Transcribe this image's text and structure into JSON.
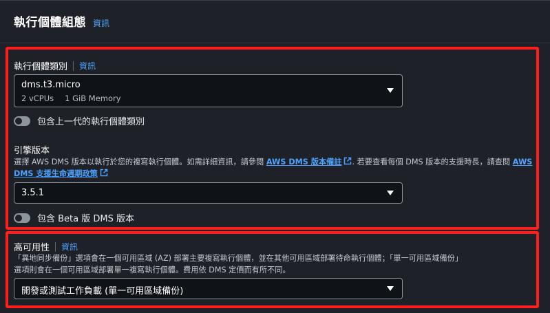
{
  "header": {
    "title": "執行個體組態",
    "info": "資訊"
  },
  "instance_class": {
    "label": "執行個體類別",
    "info": "資訊",
    "selected": "dms.t3.micro",
    "vcpus": "2 vCPUs",
    "memory": "1 GiB Memory",
    "toggle_label": "包含上一代的執行個體類別",
    "toggle_on": false
  },
  "engine_version": {
    "label": "引擎版本",
    "desc_part1": "選擇 AWS DMS 版本以執行於您的複寫執行個體。如需詳細資訊，請參閱 ",
    "link1": "AWS DMS 版本備註",
    "desc_part2": ". 若要查看每個 DMS 版本的支援時長，請查閱 ",
    "link2": "AWS DMS 支援生命週期政策",
    "selected": "3.5.1",
    "toggle_label": "包含 Beta 版 DMS 版本",
    "toggle_on": false
  },
  "high_availability": {
    "label": "高可用性",
    "info": "資訊",
    "desc_line1": "「異地同步備份」選項會在一個可用區域 (AZ) 部署主要複寫執行個體，並在其他可用區域部署待命執行個體；「單一可用區域備份」",
    "desc_line2": "選項則會在一個可用區域部署單一複寫執行個體。費用依 DMS 定價而有所不同。",
    "selected": "開發或測試工作負載 (單一可用區域備份)"
  },
  "colors": {
    "highlight": "#ff1e1e",
    "link": "#4ea3ff",
    "background": "#1e2127"
  }
}
